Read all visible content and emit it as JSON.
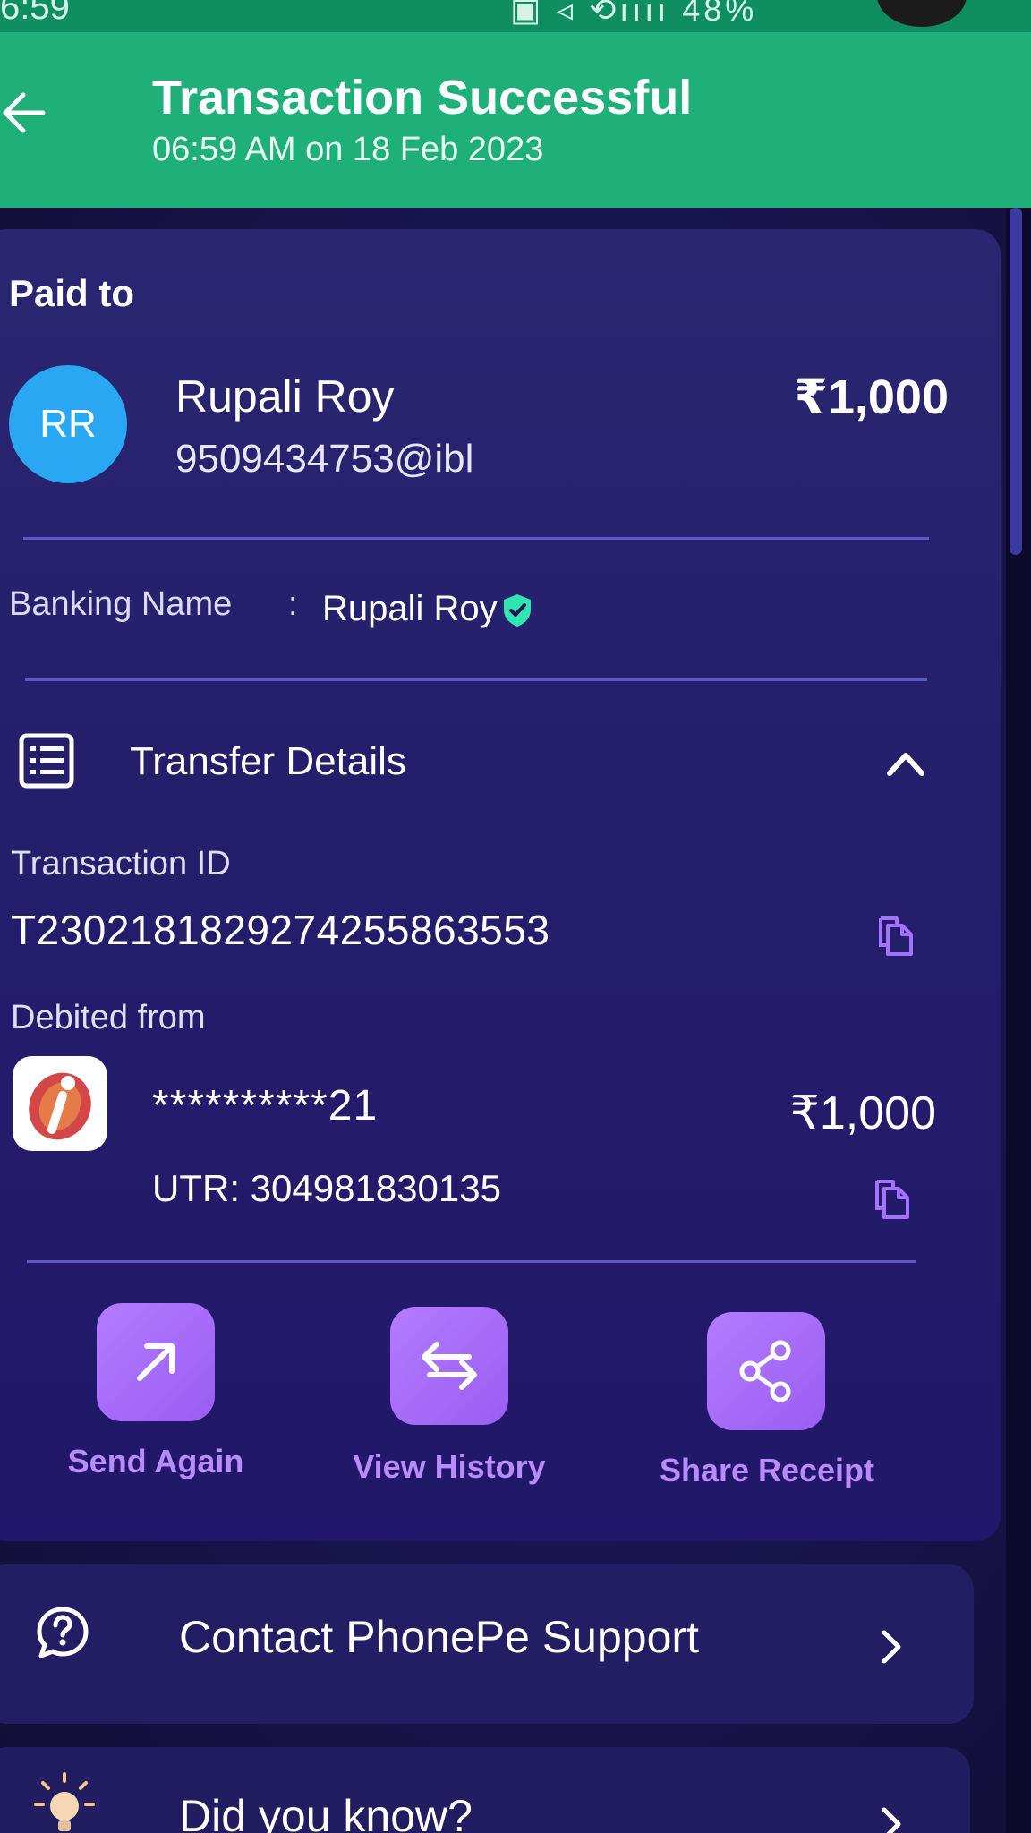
{
  "status_bar": {
    "time": "6:59",
    "right_icons": "▣ ◃ ⟲ıııı 48%"
  },
  "header": {
    "title": "Transaction Successful",
    "subtitle": "06:59 AM on 18 Feb 2023",
    "back_icon": "arrow-left-icon"
  },
  "payment": {
    "paid_to_label": "Paid to",
    "avatar_initials": "RR",
    "payee_name": "Rupali Roy",
    "payee_vpa": "9509434753@ibl",
    "amount": "₹1,000",
    "banking_name_label": "Banking Name",
    "banking_name_colon": ":",
    "banking_name_value": "Rupali Roy"
  },
  "transfer_details": {
    "title": "Transfer Details",
    "transaction_id_label": "Transaction ID",
    "transaction_id": "T2302181829274255863553",
    "debited_from_label": "Debited from",
    "masked_account": "**********21",
    "debit_amount": "₹1,000",
    "utr": "UTR: 304981830135"
  },
  "actions": [
    {
      "label": "Send Again",
      "icon": "arrow-up-right-icon"
    },
    {
      "label": "View History",
      "icon": "swap-arrows-icon"
    },
    {
      "label": "Share Receipt",
      "icon": "share-icon"
    }
  ],
  "support": {
    "label": "Contact PhonePe Support",
    "icon": "help-circle-icon"
  },
  "did_you_know": {
    "label": "Did you know?",
    "icon": "lightbulb-icon"
  },
  "colors": {
    "header_green": "#1fb07a",
    "background": "#1a1552",
    "card": "#2a2670",
    "accent_purple": "#b98bff",
    "avatar_blue": "#2aa7f2",
    "verified_green": "#2ee6b0"
  }
}
